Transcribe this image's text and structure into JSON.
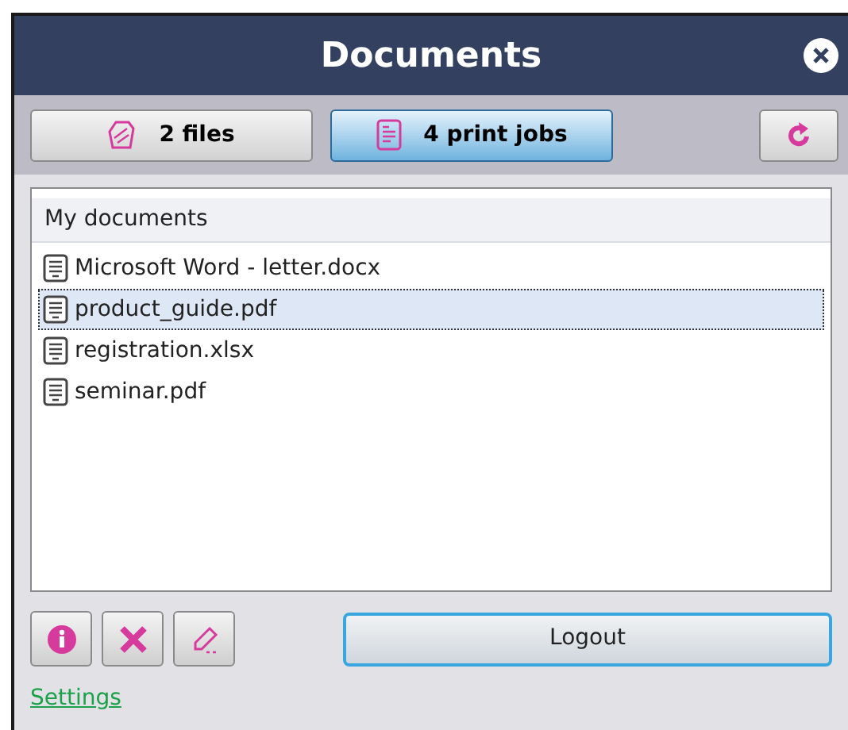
{
  "window": {
    "title": "Documents"
  },
  "tabs": [
    {
      "label": "2 files",
      "kind": "files",
      "selected": false
    },
    {
      "label": "4 print jobs",
      "kind": "jobs",
      "selected": true
    }
  ],
  "list": {
    "header": "My documents",
    "items": [
      {
        "name": "Microsoft Word - letter.docx",
        "selected": false
      },
      {
        "name": "product_guide.pdf",
        "selected": true
      },
      {
        "name": "registration.xlsx",
        "selected": false
      },
      {
        "name": "seminar.pdf",
        "selected": false
      }
    ]
  },
  "actions": [
    {
      "kind": "info"
    },
    {
      "kind": "delete"
    },
    {
      "kind": "edit"
    }
  ],
  "logout": "Logout",
  "settings": "Settings"
}
